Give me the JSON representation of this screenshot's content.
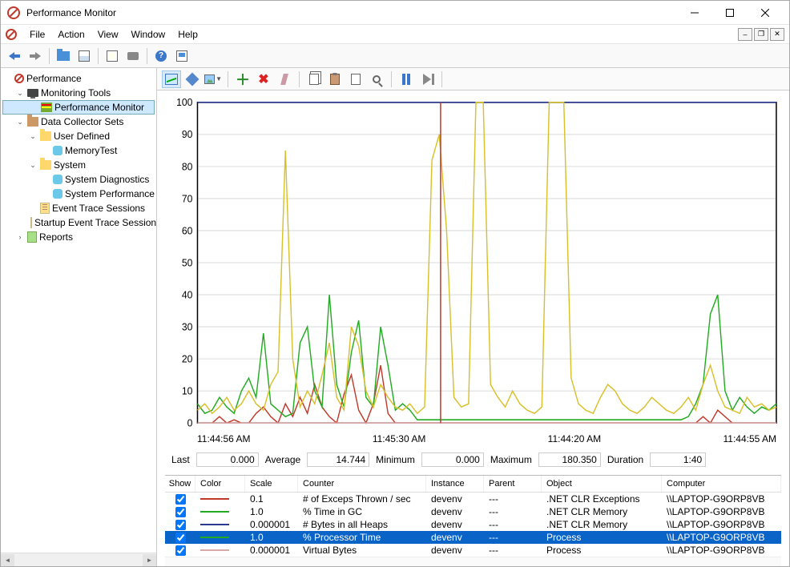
{
  "window": {
    "title": "Performance Monitor"
  },
  "menu": {
    "file": "File",
    "action": "Action",
    "view": "View",
    "window": "Window",
    "help": "Help"
  },
  "tree": {
    "root": "Performance",
    "monitoring_tools": "Monitoring Tools",
    "perf_monitor": "Performance Monitor",
    "dcs": "Data Collector Sets",
    "user_defined": "User Defined",
    "memorytest": "MemoryTest",
    "system": "System",
    "sys_diag": "System Diagnostics",
    "sys_perf": "System Performance",
    "event_trace": "Event Trace Sessions",
    "startup_trace": "Startup Event Trace Sessions",
    "reports": "Reports"
  },
  "chart_data": {
    "type": "line",
    "ylim": [
      0,
      100
    ],
    "yticks": [
      0,
      10,
      20,
      30,
      40,
      50,
      60,
      70,
      80,
      90,
      100
    ],
    "xticks": [
      "11:44:56 AM",
      "11:45:30 AM",
      "11:44:20 AM",
      "11:44:55 AM"
    ],
    "cursor_x": 0.42,
    "series": [
      {
        "name": "# of Exceps Thrown / sec",
        "color": "#c0392b",
        "values": [
          0,
          0,
          0,
          2,
          0,
          1,
          0,
          0,
          3,
          5,
          2,
          0,
          6,
          2,
          8,
          3,
          12,
          5,
          2,
          0,
          9,
          15,
          4,
          0,
          6,
          18,
          3,
          0,
          0,
          0,
          0,
          0,
          0,
          0,
          0,
          0,
          0,
          0,
          0,
          0,
          0,
          0,
          0,
          0,
          0,
          0,
          0,
          0,
          0,
          0,
          0,
          0,
          0,
          0,
          0,
          0,
          0,
          0,
          0,
          0,
          0,
          0,
          0,
          0,
          0,
          0,
          0,
          0,
          0,
          2,
          0,
          4,
          2,
          0,
          0,
          0,
          0,
          0,
          0,
          0
        ]
      },
      {
        "name": "% Time in GC",
        "color": "#22aa22",
        "values": [
          6,
          3,
          4,
          8,
          5,
          3,
          10,
          14,
          8,
          28,
          6,
          4,
          2,
          3,
          25,
          30,
          10,
          5,
          40,
          12,
          5,
          22,
          32,
          8,
          5,
          30,
          18,
          4,
          6,
          4,
          1,
          1,
          1,
          1,
          1,
          1,
          1,
          1,
          1,
          1,
          1,
          1,
          1,
          1,
          1,
          1,
          1,
          1,
          1,
          1,
          1,
          1,
          1,
          1,
          1,
          1,
          1,
          1,
          1,
          1,
          1,
          1,
          1,
          1,
          1,
          1,
          1,
          2,
          6,
          12,
          34,
          40,
          10,
          4,
          8,
          5,
          3,
          5,
          4,
          6
        ]
      },
      {
        "name": "# Bytes in all Heaps",
        "color": "#2b3a8f",
        "values": [
          100,
          100,
          100,
          100,
          100,
          100,
          100,
          100,
          100,
          100,
          100,
          100,
          100,
          100,
          100,
          100,
          100,
          100,
          100,
          100,
          100,
          100,
          100,
          100,
          100,
          100,
          100,
          100,
          100,
          100,
          100,
          100,
          100,
          100,
          100,
          100,
          100,
          100,
          100,
          100,
          100,
          100,
          100,
          100,
          100,
          100,
          100,
          100,
          100,
          100,
          100,
          100,
          100,
          100,
          100,
          100,
          100,
          100,
          100,
          100,
          100,
          100,
          100,
          100,
          100,
          100,
          100,
          100,
          100,
          100,
          100,
          100,
          100,
          100,
          100,
          100,
          100,
          100,
          100,
          100
        ]
      },
      {
        "name": "% Processor Time",
        "color": "#d8c02a",
        "values": [
          4,
          6,
          3,
          5,
          8,
          4,
          6,
          10,
          6,
          4,
          12,
          16,
          85,
          20,
          5,
          10,
          6,
          15,
          25,
          8,
          4,
          30,
          24,
          10,
          5,
          12,
          8,
          5,
          4,
          6,
          3,
          5,
          82,
          90,
          60,
          8,
          5,
          6,
          100,
          100,
          12,
          8,
          5,
          10,
          6,
          4,
          3,
          5,
          100,
          100,
          100,
          14,
          6,
          4,
          3,
          8,
          12,
          10,
          6,
          4,
          3,
          5,
          8,
          6,
          4,
          3,
          5,
          8,
          4,
          12,
          18,
          10,
          5,
          4,
          3,
          8,
          5,
          6,
          4,
          5
        ]
      },
      {
        "name": "Virtual Bytes",
        "color": "#d9a8a8",
        "values": [
          0,
          0,
          0,
          0,
          0,
          0,
          0,
          0,
          0,
          0,
          0,
          0,
          0,
          0,
          0,
          0,
          0,
          0,
          0,
          0,
          0,
          0,
          0,
          0,
          0,
          0,
          0,
          0,
          0,
          0,
          0,
          0,
          0,
          0,
          0,
          0,
          0,
          0,
          0,
          0,
          0,
          0,
          0,
          0,
          0,
          0,
          0,
          0,
          0,
          0,
          0,
          0,
          0,
          0,
          0,
          0,
          0,
          0,
          0,
          0,
          0,
          0,
          0,
          0,
          0,
          0,
          0,
          0,
          0,
          0,
          0,
          0,
          0,
          0,
          0,
          0,
          0,
          0,
          0,
          0
        ]
      }
    ]
  },
  "stats": {
    "last_label": "Last",
    "last": "0.000",
    "avg_label": "Average",
    "avg": "14.744",
    "min_label": "Minimum",
    "min": "0.000",
    "max_label": "Maximum",
    "max": "180.350",
    "dur_label": "Duration",
    "dur": "1:40"
  },
  "table": {
    "headers": {
      "show": "Show",
      "color": "Color",
      "scale": "Scale",
      "counter": "Counter",
      "instance": "Instance",
      "parent": "Parent",
      "object": "Object",
      "computer": "Computer"
    },
    "rows": [
      {
        "show": true,
        "colorhex": "#c0392b",
        "scale": "0.1",
        "counter": "# of Exceps Thrown / sec",
        "instance": "devenv",
        "parent": "---",
        "object": ".NET CLR Exceptions",
        "computer": "\\\\LAPTOP-G9ORP8VB",
        "selected": false
      },
      {
        "show": true,
        "colorhex": "#22aa22",
        "scale": "1.0",
        "counter": "% Time in GC",
        "instance": "devenv",
        "parent": "---",
        "object": ".NET CLR Memory",
        "computer": "\\\\LAPTOP-G9ORP8VB",
        "selected": false
      },
      {
        "show": true,
        "colorhex": "#2b3a8f",
        "scale": "0.000001",
        "counter": "# Bytes in all Heaps",
        "instance": "devenv",
        "parent": "---",
        "object": ".NET CLR Memory",
        "computer": "\\\\LAPTOP-G9ORP8VB",
        "selected": false
      },
      {
        "show": true,
        "colorhex": "#22aa22",
        "scale": "1.0",
        "counter": "% Processor Time",
        "instance": "devenv",
        "parent": "---",
        "object": "Process",
        "computer": "\\\\LAPTOP-G9ORP8VB",
        "selected": true
      },
      {
        "show": true,
        "colorhex": "#d9a8a8",
        "scale": "0.000001",
        "counter": "Virtual Bytes",
        "instance": "devenv",
        "parent": "---",
        "object": "Process",
        "computer": "\\\\LAPTOP-G9ORP8VB",
        "selected": false
      }
    ]
  }
}
